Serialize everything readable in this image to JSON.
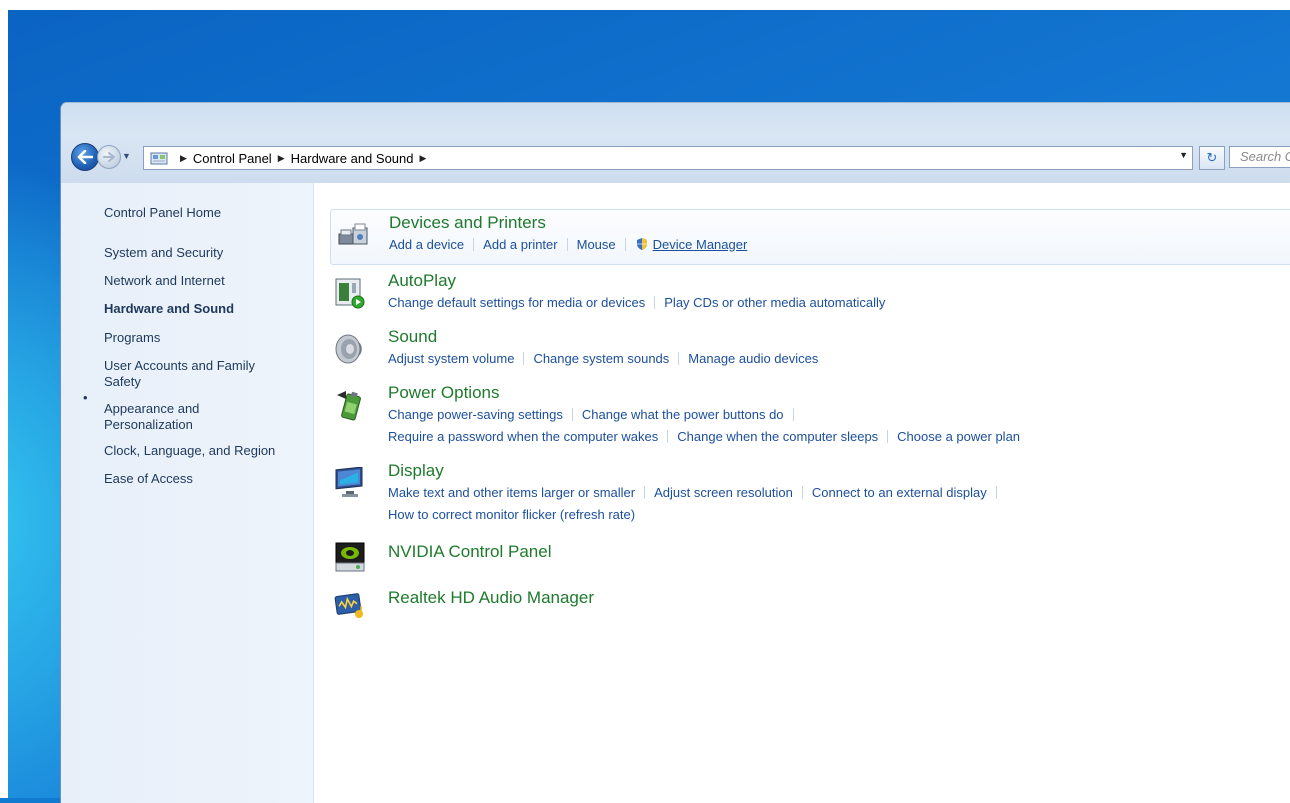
{
  "address": {
    "crumbs": [
      "Control Panel",
      "Hardware and Sound"
    ],
    "search_placeholder": "Search C"
  },
  "sidebar": {
    "home": "Control Panel Home",
    "items": [
      {
        "label": "System and Security"
      },
      {
        "label": "Network and Internet"
      },
      {
        "label": "Hardware and Sound",
        "active": true
      },
      {
        "label": "Programs"
      },
      {
        "label": "User Accounts and Family Safety"
      },
      {
        "label": "Appearance and Personalization"
      },
      {
        "label": "Clock, Language, and Region"
      },
      {
        "label": "Ease of Access"
      }
    ]
  },
  "categories": [
    {
      "title": "Devices and Printers",
      "icon": "printer-icon",
      "links": [
        "Add a device",
        "Add a printer",
        "Mouse",
        "Device Manager"
      ]
    },
    {
      "title": "AutoPlay",
      "icon": "autoplay-icon",
      "links": [
        "Change default settings for media or devices",
        "Play CDs or other media automatically"
      ]
    },
    {
      "title": "Sound",
      "icon": "speaker-icon",
      "links": [
        "Adjust system volume",
        "Change system sounds",
        "Manage audio devices"
      ]
    },
    {
      "title": "Power Options",
      "icon": "battery-icon",
      "links": [
        "Change power-saving settings",
        "Change what the power buttons do"
      ],
      "links2": [
        "Require a password when the computer wakes",
        "Change when the computer sleeps",
        "Choose a power plan"
      ]
    },
    {
      "title": "Display",
      "icon": "monitor-icon",
      "links": [
        "Make text and other items larger or smaller",
        "Adjust screen resolution",
        "Connect to an external display"
      ],
      "links2": [
        "How to correct monitor flicker (refresh rate)"
      ]
    },
    {
      "title": "NVIDIA Control Panel",
      "icon": "nvidia-icon",
      "links": []
    },
    {
      "title": "Realtek HD Audio Manager",
      "icon": "realtek-icon",
      "links": []
    }
  ],
  "colors": {
    "category_title": "#1e7a2c",
    "link": "#1c4f9c",
    "sidebar_text": "#1e395b",
    "desktop_blue": "#1478d3"
  }
}
